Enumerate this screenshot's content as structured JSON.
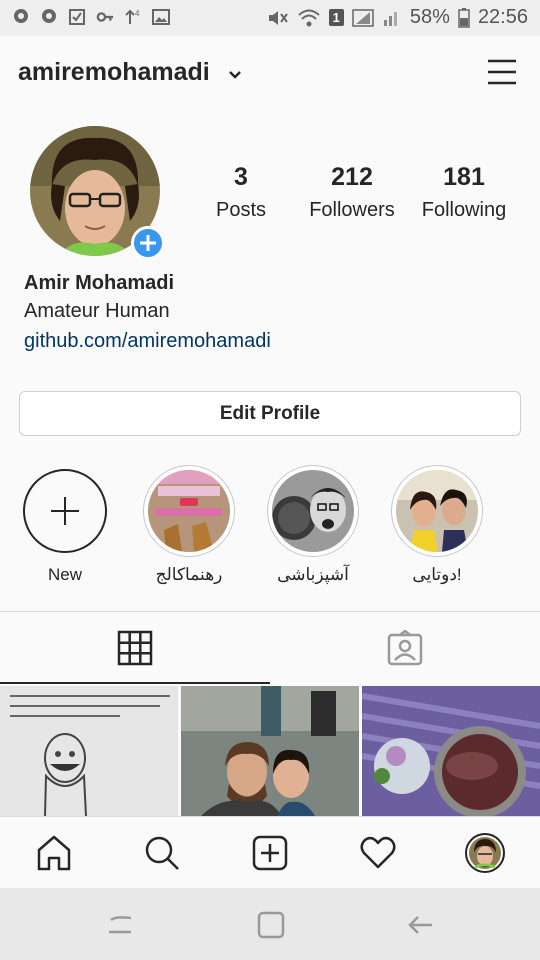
{
  "status_bar": {
    "battery": "58%",
    "time": "22:56",
    "sim": "1"
  },
  "header": {
    "username": "amiremohamadi"
  },
  "profile": {
    "stats": [
      {
        "value": "3",
        "label": "Posts"
      },
      {
        "value": "212",
        "label": "Followers"
      },
      {
        "value": "181",
        "label": "Following"
      }
    ],
    "full_name": "Amir Mohamadi",
    "bio": "Amateur Human",
    "website": "github.com/amiremohamadi",
    "edit_button": "Edit Profile"
  },
  "highlights": [
    {
      "caption": "New"
    },
    {
      "caption": "رهنماکالج"
    },
    {
      "caption": "آشپزباشی"
    },
    {
      "caption": "دوتایی!"
    }
  ],
  "colors": {
    "accent": "#3897f0",
    "link": "#003569",
    "text": "#262626",
    "border": "#dbdbdb"
  },
  "icons": [
    "chevron-down-icon",
    "menu-icon",
    "plus-icon",
    "grid-icon",
    "tagged-icon",
    "home-icon",
    "search-icon",
    "add-post-icon",
    "heart-icon",
    "profile-icon",
    "recents-icon",
    "system-home-icon",
    "back-icon"
  ]
}
